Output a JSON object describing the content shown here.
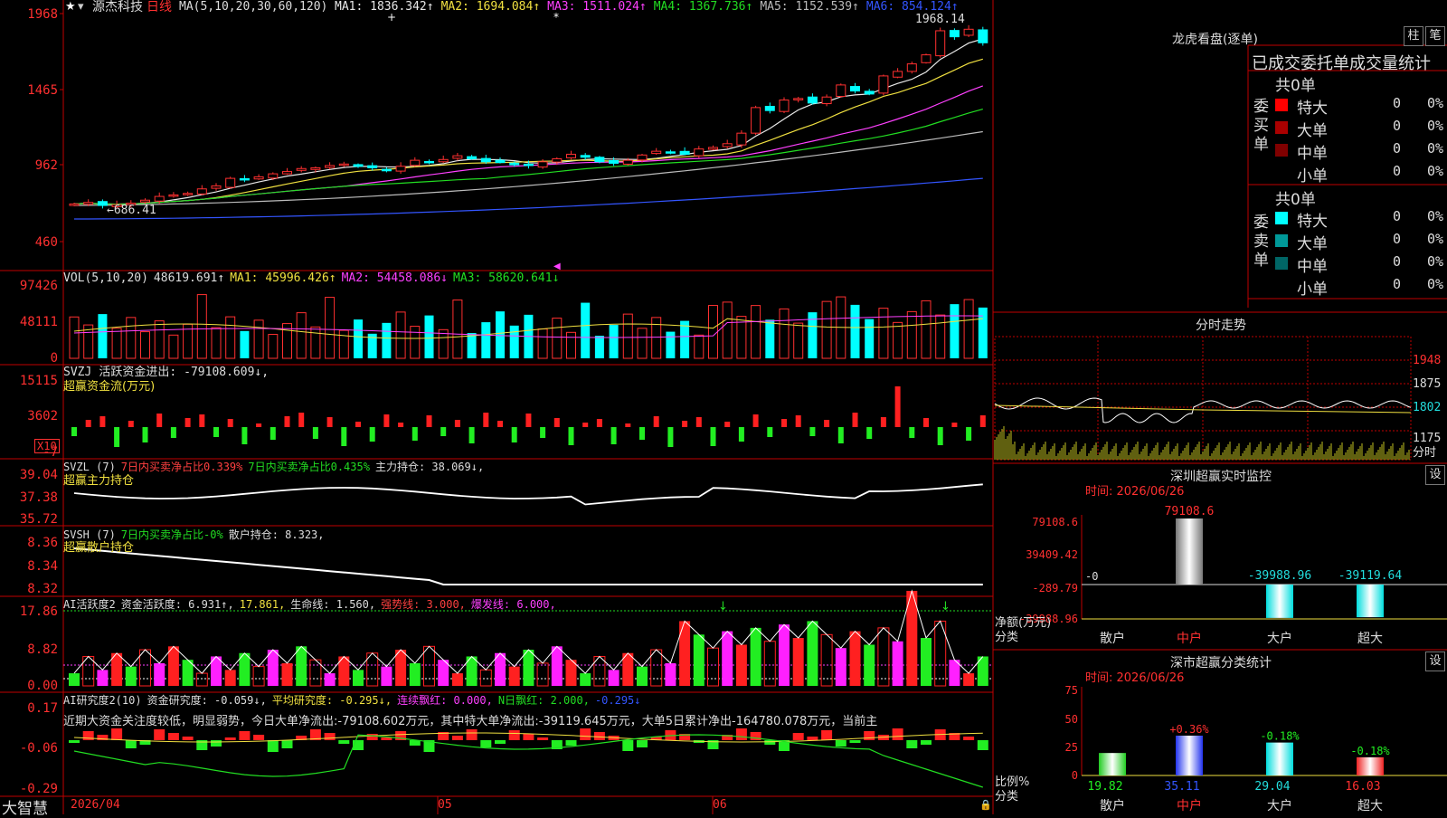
{
  "stock": {
    "name": "源杰科技",
    "period": "日线",
    "ma_header": "MA(5,10,20,30,60,120)",
    "ma_items": [
      {
        "label": "MA1:",
        "value": "1836.342↑",
        "color": "#e8e8e8"
      },
      {
        "label": "MA2:",
        "value": "1694.084↑",
        "color": "#f0e040"
      },
      {
        "label": "MA3:",
        "value": "1511.024↑",
        "color": "#ff40ff"
      },
      {
        "label": "MA4:",
        "value": "1367.736↑",
        "color": "#22dd22"
      },
      {
        "label": "MA5:",
        "value": "1152.539↑",
        "color": "#bbbbbb"
      },
      {
        "label": "MA6:",
        "value": "854.124↑",
        "color": "#3355ff"
      }
    ],
    "high_label": "1968.14",
    "low_label": "686.41",
    "main_axis": [
      "1968",
      "1465",
      "962",
      "460"
    ]
  },
  "vol": {
    "header": "VOL(5,10,20)",
    "value": "48619.691↑",
    "items": [
      {
        "label": "MA1:",
        "value": "45996.426↑",
        "color": "#f0e040"
      },
      {
        "label": "MA2:",
        "value": "54458.086↓",
        "color": "#ff40ff"
      },
      {
        "label": "MA3:",
        "value": "58620.641↓",
        "color": "#22dd22"
      }
    ],
    "axis": [
      "97426",
      "48111",
      "0"
    ]
  },
  "svzj": {
    "header": "SVZJ",
    "label": "活跃资金进出:",
    "value": "-79108.609↓,",
    "sub": "超赢资金流(万元)",
    "axis": [
      "15115",
      "3602",
      "-7"
    ],
    "mult": "X10"
  },
  "svzl": {
    "header": "SVZL (7)",
    "t1": "7日内买卖净占比0.339%",
    "t2": "7日内买卖净占比0.435%",
    "t3": "主力持仓: 38.069↓,",
    "sub": "超赢主力持仓",
    "axis": [
      "39.04",
      "37.38",
      "35.72"
    ]
  },
  "svsh": {
    "header": "SVSH (7)",
    "t1": "7日内买卖净占比-0%",
    "t2": "散户持仓: 8.323,",
    "sub": "超赢散户持仓",
    "axis": [
      "8.36",
      "8.34",
      "8.32"
    ]
  },
  "ai1": {
    "header": "AI活跃度2",
    "t1": "资金活跃度: 6.931↑,",
    "t2": "17.861,",
    "t3": "生命线: 1.560,",
    "t4": "强势线: 3.000,",
    "t5": "爆发线: 6.000,",
    "axis": [
      "17.86",
      "8.82",
      "0.00"
    ]
  },
  "ai2": {
    "header": "AI研究度2(10)",
    "t1": "资金研究度: -0.059↓,",
    "t2": "平均研究度: -0.295↓,",
    "t3": "连续飘红: 0.000,",
    "t4": "N日飘红: 2.000,",
    "t5": "-0.295↓",
    "note": "近期大资金关注度较低，明显弱势，今日大单净流出:-79108.602万元，其中特大单净流出:-39119.645万元，大单5日累计净出-164780.078万元，当前主",
    "axis": [
      "0.17",
      "-0.06",
      "-0.29"
    ]
  },
  "bottom": {
    "logo": "大智慧",
    "dates": [
      "2026/04",
      "05",
      "06"
    ]
  },
  "lhb": {
    "title": "龙虎看盘(逐单)",
    "btn1": "柱",
    "btn2": "笔",
    "heading": "已成交委托单成交量统计",
    "buy_side": "委买单",
    "sell_side": "委卖单",
    "buy_total": "共0单",
    "sell_total": "共0单",
    "buy_rows": [
      {
        "label": "特大",
        "val": "0",
        "pct": "0%",
        "color": "#ff0000"
      },
      {
        "label": "大单",
        "val": "0",
        "pct": "0%",
        "color": "#aa0000"
      },
      {
        "label": "中单",
        "val": "0",
        "pct": "0%",
        "color": "#800000"
      },
      {
        "label": "小单",
        "val": "0",
        "pct": "0%",
        "color": "#000000"
      }
    ],
    "sell_rows": [
      {
        "label": "特大",
        "val": "0",
        "pct": "0%",
        "color": "#00ffff"
      },
      {
        "label": "大单",
        "val": "0",
        "pct": "0%",
        "color": "#009999"
      },
      {
        "label": "中单",
        "val": "0",
        "pct": "0%",
        "color": "#006666"
      },
      {
        "label": "小单",
        "val": "0",
        "pct": "0%",
        "color": "#000000"
      }
    ]
  },
  "intraday": {
    "title": "分时走势",
    "axis": [
      "1948",
      "1875",
      "1802",
      "1175"
    ],
    "label": "分时"
  },
  "sz_monitor": {
    "title": "深圳超赢实时监控",
    "btn": "设",
    "time": "时间: 2026/06/26",
    "axis": [
      "79108.6",
      "39409.42",
      "-289.79",
      "-39988.96"
    ],
    "zero": "-0",
    "ylabel": "净额(万元)",
    "xlabel": "分类",
    "cats": [
      "散户",
      "中户",
      "大户",
      "超大"
    ],
    "values": [
      0,
      79108.6,
      -39988.96,
      -39119.64
    ],
    "value_labels": [
      "",
      "79108.6",
      "-39988.96",
      "-39119.64"
    ]
  },
  "sz_stats": {
    "title": "深市超赢分类统计",
    "btn": "设",
    "time": "时间: 2026/06/26",
    "axis": [
      "75",
      "50",
      "25",
      "0"
    ],
    "ylabel": "比例%",
    "xlabel": "分类",
    "cats": [
      "散户",
      "中户",
      "大户",
      "超大"
    ],
    "values": [
      19.82,
      35.11,
      29.04,
      16.03
    ],
    "value_labels": [
      "19.82",
      "35.11",
      "29.04",
      "16.03"
    ],
    "changes": [
      "",
      "+0.36%",
      "-0.18%",
      "-0.18%"
    ]
  },
  "chart_data": {
    "type": "candlestick",
    "closes": [
      710,
      720,
      700,
      705,
      715,
      735,
      760,
      770,
      780,
      810,
      830,
      880,
      870,
      890,
      910,
      925,
      945,
      950,
      965,
      975,
      960,
      950,
      930,
      960,
      1000,
      990,
      1005,
      1030,
      1010,
      990,
      985,
      970,
      965,
      990,
      1010,
      1040,
      1020,
      990,
      980,
      1000,
      1035,
      1060,
      1055,
      1040,
      1075,
      1085,
      1110,
      1180,
      1350,
      1330,
      1400,
      1410,
      1380,
      1420,
      1500,
      1460,
      1440,
      1560,
      1590,
      1640,
      1700,
      1860,
      1820,
      1870,
      1780
    ],
    "x_labels": [
      "2026/04",
      "05",
      "06"
    ]
  }
}
